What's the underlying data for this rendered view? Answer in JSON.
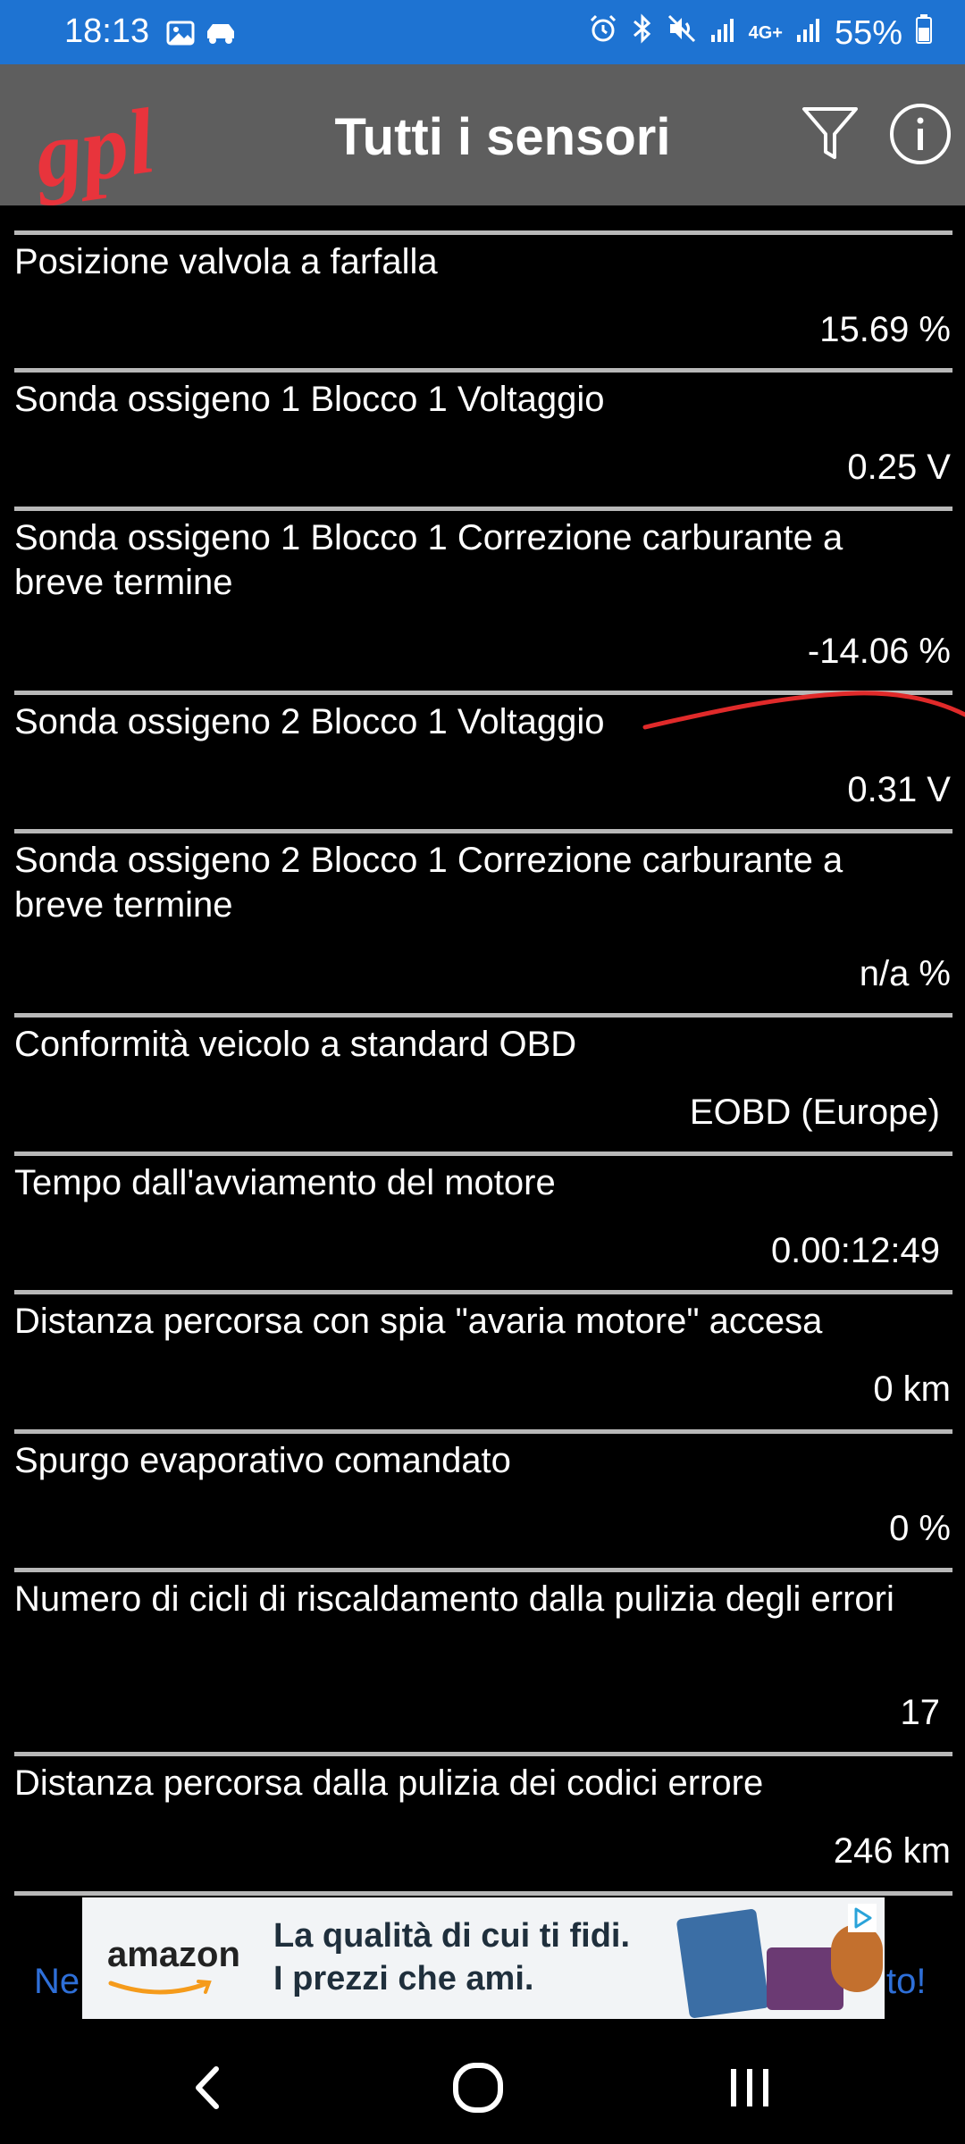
{
  "status_bar": {
    "time": "18:13",
    "battery": "55%",
    "network": "4G+",
    "left_icons": [
      "image-icon",
      "car-icon"
    ],
    "right_icons": [
      "alarm-icon",
      "bluetooth-icon",
      "mute-icon",
      "signal-icon",
      "signal-icon",
      "battery-icon"
    ]
  },
  "app_bar": {
    "logo": "gpl",
    "title": "Tutti i sensori",
    "actions": [
      "filter-icon",
      "info-icon"
    ]
  },
  "sensors": [
    {
      "label": "Posizione valvola a farfalla",
      "value": "15.69 %"
    },
    {
      "label": "Sonda ossigeno 1 Blocco 1 Voltaggio",
      "value": "0.25 V"
    },
    {
      "label": "Sonda ossigeno 1 Blocco 1 Correzione carburante a breve termine",
      "value": "-14.06 %"
    },
    {
      "label": "Sonda ossigeno 2 Blocco 1 Voltaggio",
      "value": "0.31 V"
    },
    {
      "label": "Sonda ossigeno 2 Blocco 1 Correzione carburante a breve termine",
      "value": "n/a %"
    },
    {
      "label": "Conformità veicolo a standard OBD",
      "value": "EOBD (Europe)"
    },
    {
      "label": "Tempo dall'avviamento del motore",
      "value": "0.00:12:49"
    },
    {
      "label": "Distanza percorsa con spia \"avaria motore\" accesa",
      "value": "0 km"
    },
    {
      "label": "Spurgo evaporativo comandato",
      "value": "0 %"
    },
    {
      "label": "Numero di cicli di riscaldamento dalla pulizia degli errori",
      "value": "17"
    },
    {
      "label": "Distanza percorsa dalla pulizia dei codici errore",
      "value": "246 km"
    }
  ],
  "ad": {
    "side_left": "Ne",
    "side_right": "to!",
    "brand": "amazon",
    "line1": "La qualità di cui ti fidi.",
    "line2": "I prezzi che ami."
  },
  "nav_bar": [
    "back-icon",
    "home-icon",
    "recents-icon"
  ],
  "colors": {
    "status_bar": "#1e73d2",
    "app_bar": "#5e5e5e",
    "logo": "#e8343c",
    "separator": "#b8b8b8",
    "ad_link": "#2e6fd8"
  }
}
